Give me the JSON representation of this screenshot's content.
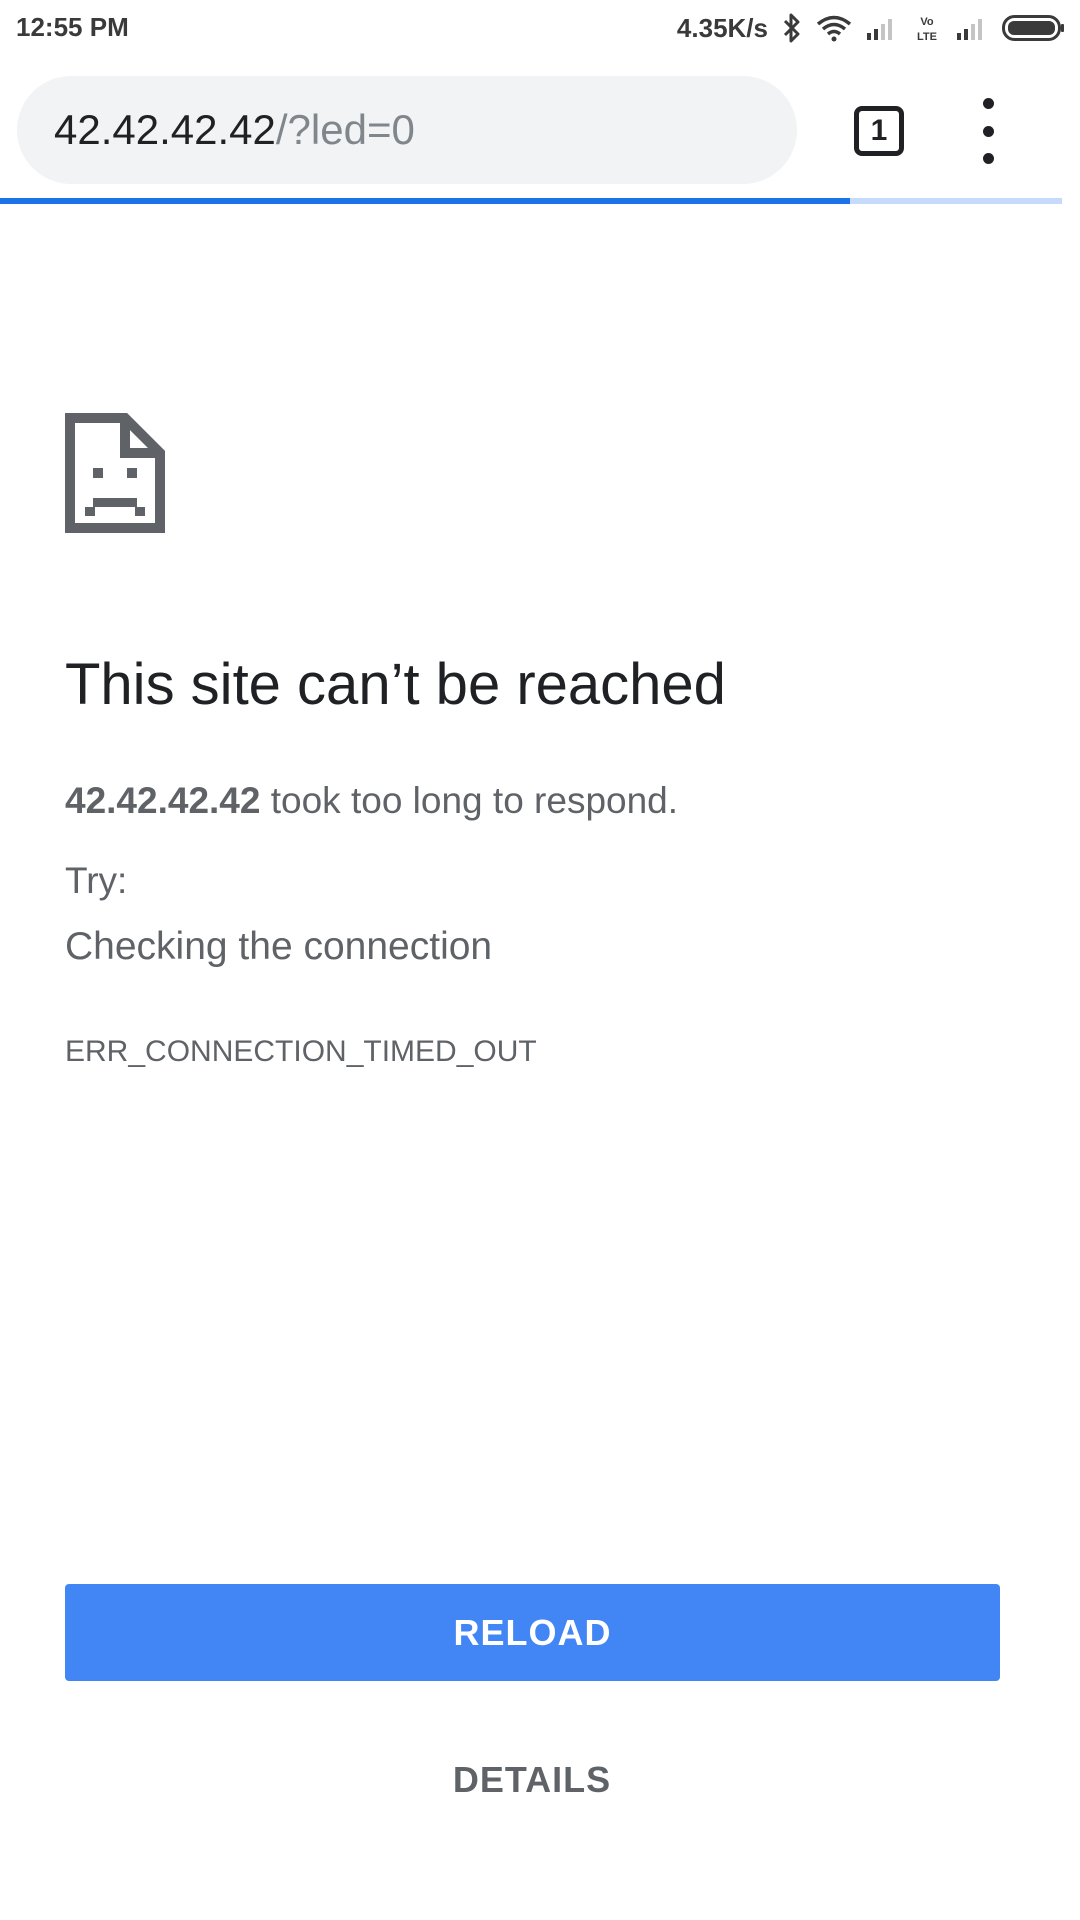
{
  "status_bar": {
    "time": "12:55 PM",
    "net_speed": "4.35K/s",
    "icons": [
      "bluetooth-icon",
      "wifi-icon",
      "signal-icon",
      "volte-icon",
      "signal-icon",
      "battery-icon"
    ],
    "volte_line1": "Vo",
    "volte_line2": "LTE"
  },
  "toolbar": {
    "url_host": "42.42.42.42",
    "url_path": "/?led=0",
    "tab_count": "1",
    "menu_icon": "more-vert-icon",
    "load_progress": 0.8
  },
  "error": {
    "icon": "sad-page-icon",
    "title": "This site can’t be reached",
    "host": "42.42.42.42",
    "message": " took too long to respond.",
    "try_label": "Try:",
    "suggestion": "Checking the connection",
    "code": "ERR_CONNECTION_TIMED_OUT"
  },
  "buttons": {
    "reload": "RELOAD",
    "details": "DETAILS"
  },
  "colors": {
    "accent": "#4285f4",
    "progress": "#1a73e8",
    "text": "#5f6368"
  }
}
